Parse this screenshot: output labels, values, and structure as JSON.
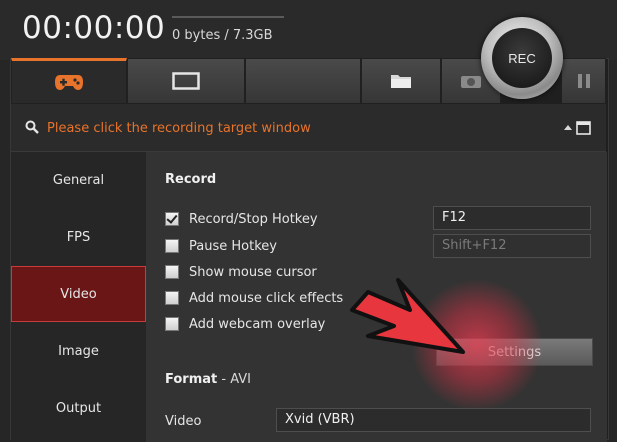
{
  "header": {
    "timer": "00:00:00",
    "storage": "0 bytes / 7.3GB",
    "rec_label": "REC"
  },
  "tabs": [
    {
      "name": "game",
      "icon": "gamepad-icon",
      "active": true
    },
    {
      "name": "screen",
      "icon": "screen-icon",
      "active": false
    },
    {
      "name": "blank",
      "icon": "",
      "active": false
    },
    {
      "name": "folder",
      "icon": "folder-icon",
      "active": false
    },
    {
      "name": "camera",
      "icon": "camera-icon",
      "active": false
    },
    {
      "name": "pause",
      "icon": "pause-icon",
      "active": false
    }
  ],
  "search": {
    "prompt": "Please click the recording target window"
  },
  "sidebar": {
    "items": [
      {
        "label": "General"
      },
      {
        "label": "FPS"
      },
      {
        "label": "Video",
        "active": true
      },
      {
        "label": "Image"
      },
      {
        "label": "Output"
      }
    ]
  },
  "record": {
    "title": "Record",
    "options": [
      {
        "label": "Record/Stop Hotkey",
        "checked": true
      },
      {
        "label": "Pause Hotkey",
        "checked": false
      },
      {
        "label": "Show mouse cursor",
        "checked": false
      },
      {
        "label": "Add mouse click effects",
        "checked": false
      },
      {
        "label": "Add webcam overlay",
        "checked": false
      }
    ],
    "hotkey_record": "F12",
    "hotkey_pause": "Shift+F12",
    "settings_label": "Settings"
  },
  "format": {
    "title": "Format",
    "title_sep": " - ",
    "container": "AVI",
    "video_label": "Video",
    "video_codec": "Xvid (VBR)"
  },
  "colors": {
    "accent_orange": "#e8732a",
    "sidebar_active": "#6a1616",
    "highlight_red": "#e03c50"
  }
}
